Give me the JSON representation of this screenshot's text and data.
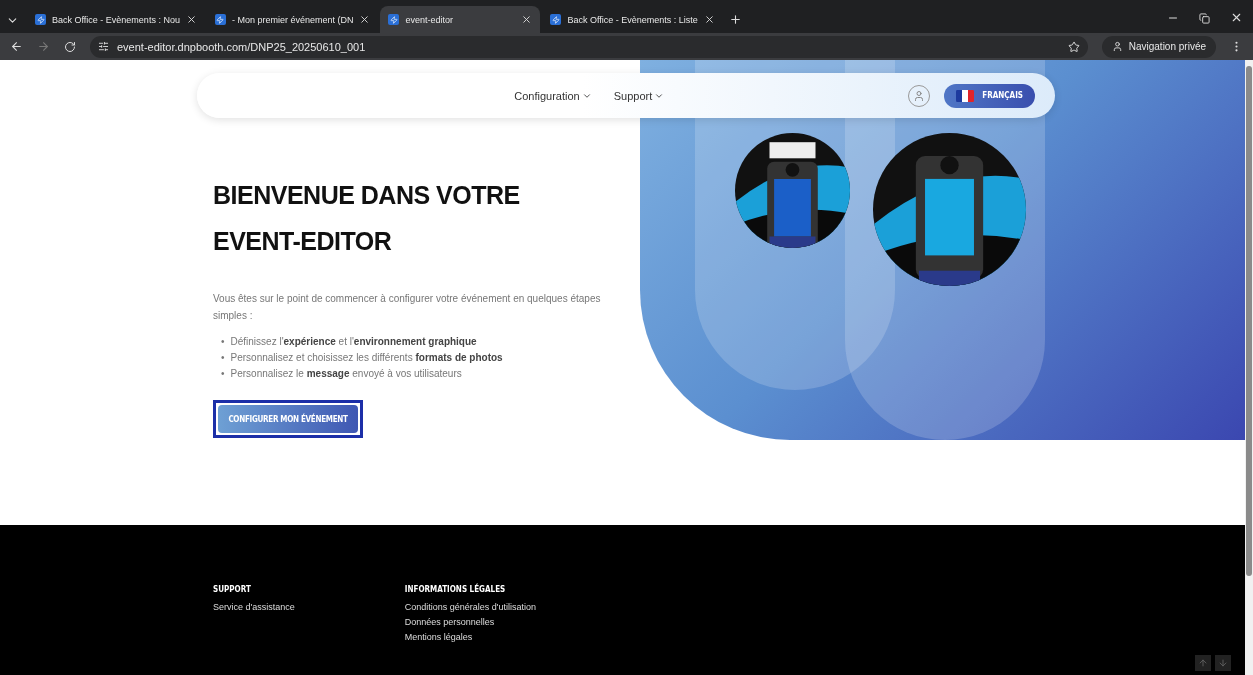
{
  "browser": {
    "tabs": [
      {
        "label": "Back Office - Evènements : Nou",
        "selected": false
      },
      {
        "label": "- Mon premier événement (DN",
        "selected": false
      },
      {
        "label": "event-editor",
        "selected": true
      },
      {
        "label": "Back Office - Evènements : Liste",
        "selected": false
      }
    ],
    "url": "event-editor.dnpbooth.com/DNP25_20250610_001",
    "private_label": "Navigation privée"
  },
  "nav": {
    "menus": [
      "Configuration",
      "Support"
    ],
    "language": "FRANÇAIS"
  },
  "hero": {
    "title": "BIENVENUE DANS VOTRE EVENT-EDITOR",
    "intro": "Vous êtes sur le point de commencer à configurer votre événement en quelques étapes simples :",
    "bullets": [
      {
        "marker": "•",
        "text": "Définissez l'**expérience** et l'**environnement graphique**"
      },
      {
        "marker": "•",
        "text": "Personnalisez et choisissez les différents **formats de photos**"
      },
      {
        "marker": "•",
        "text": "Personnalisez le **message** envoyé à vos utilisateurs"
      }
    ],
    "button": "CONFIGURER MON ÉVÉNEMENT"
  },
  "footer": {
    "columns": [
      {
        "heading": "SUPPORT",
        "links": [
          "Service d'assistance"
        ]
      },
      {
        "heading": "INFORMATIONS LÉGALES",
        "links": [
          "Conditions générales d'utilisation",
          "Données personnelles",
          "Mentions légales"
        ]
      }
    ]
  }
}
